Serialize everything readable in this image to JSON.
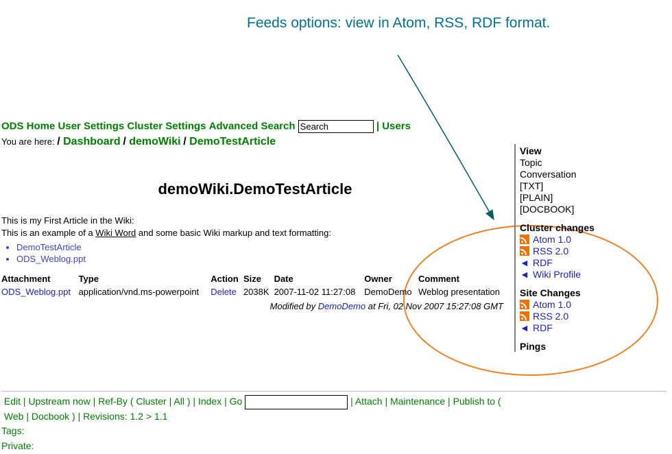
{
  "annotation": "Feeds options: view in Atom, RSS, RDF format.",
  "topnav": {
    "ods_home": "ODS Home",
    "user_settings": "User Settings",
    "cluster_settings": "Cluster Settings",
    "advanced_search": "Advanced Search",
    "search_value": "Search",
    "users": "Users"
  },
  "breadcrumb": {
    "you_are_here": "You are here:",
    "dashboard": "Dashboard",
    "wiki": "demoWiki",
    "article": "DemoTestArticle"
  },
  "title": "demoWiki.DemoTestArticle",
  "body": {
    "line1": "This is my First Article in the Wiki:",
    "line2_pre": "This is an example of a ",
    "wiki_word": "Wiki Word",
    "line2_post": " and some basic Wiki markup and text formatting:",
    "list": [
      "DemoTestArticle",
      "ODS_Weblog.ppt"
    ]
  },
  "att_table": {
    "headers": {
      "attachment": "Attachment",
      "type": "Type",
      "action": "Action",
      "size": "Size",
      "date": "Date",
      "owner": "Owner",
      "comment": "Comment"
    },
    "row": {
      "attachment": "ODS_Weblog.ppt",
      "type": "application/vnd.ms-powerpoint",
      "action": "Delete",
      "size": "2038K",
      "date": "2007-11-02 11:27:08",
      "owner": "DemoDemo",
      "comment": "Weblog presentation"
    }
  },
  "modified": {
    "prefix": "Modified by ",
    "user": "DemoDemo",
    "middle": " at ",
    "time": "Fri, 02 Nov 2007 15:27:08 GMT"
  },
  "sidebar": {
    "view_h": "View",
    "view_items": [
      "Topic",
      "Conversation",
      "[TXT]",
      "[PLAIN]",
      "[DOCBOOK]"
    ],
    "cluster_h": "Cluster changes",
    "atom": "Atom 1.0",
    "rss": "RSS 2.0",
    "rdf": "RDF",
    "wiki_profile": "Wiki Profile",
    "site_h": "Site Changes",
    "pings_h": "Pings"
  },
  "bottom": {
    "edit": "Edit",
    "upstream": "Upstream now",
    "refby": "Ref-By",
    "cluster": "Cluster",
    "all": "All",
    "index": "Index",
    "go": "Go",
    "attach": "Attach",
    "maintenance": "Maintenance",
    "publish": "Publish to",
    "web": "Web",
    "docbook": "Docbook",
    "revisions": "Revisions: 1.2 > 1.1",
    "tags": "Tags:",
    "private": "Private:"
  }
}
